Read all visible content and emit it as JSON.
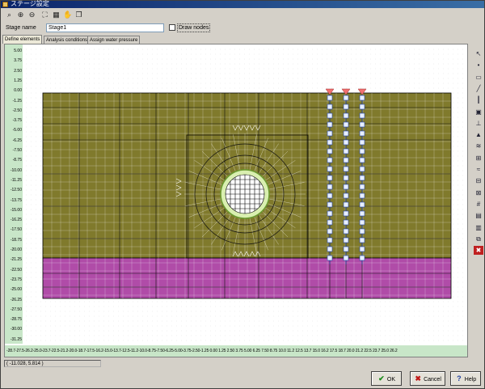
{
  "window": {
    "title": "ステージ設定"
  },
  "toolbar": {
    "icons": [
      "zoom-window-icon",
      "zoom-in-icon",
      "zoom-out-icon",
      "fit-icon",
      "grid-icon",
      "pan-hand-icon",
      "copy-icon"
    ]
  },
  "stage": {
    "label": "Stage name",
    "value": "Stage1",
    "draw_nodes_label": "Draw nodes",
    "draw_nodes_checked": false
  },
  "tabs": [
    {
      "label": "Define elements",
      "active": true
    },
    {
      "label": "Analysis conditions",
      "active": false
    },
    {
      "label": "Assign water pressure",
      "active": false
    }
  ],
  "axes": {
    "y_ticks": [
      "5.00",
      "3.75",
      "2.50",
      "1.25",
      "0.00",
      "-1.25",
      "-2.50",
      "-3.75",
      "-5.00",
      "-6.25",
      "-7.50",
      "-8.75",
      "-10.00",
      "-11.25",
      "-12.50",
      "-13.75",
      "-15.00",
      "-16.25",
      "-17.50",
      "-18.75",
      "-20.00",
      "-21.25",
      "-22.50",
      "-23.75",
      "-25.00",
      "-26.25",
      "-27.50",
      "-28.75",
      "-30.00",
      "-31.25"
    ],
    "x_ticks": "-28.7-27.5-26.2-25.0-23.7-22.5-21.2-20.0-18.7-17.5-16.2-15.0-13.7-12.5-11.2-10.0-8.75-7.50-6.25-5.00-3.75-2.50-1.25 0.00 1.25 2.50 3.75 5.00 6.25 7.50 8.75 10.0 11.2 12.5 13.7 15.0 16.2 17.5 18.7 20.0 21.2 22.5 23.7 25.0 26.2"
  },
  "model": {
    "upper_layer_color": "#807a2c",
    "lower_layer_color": "#b04ca8",
    "tunnel_fill_color": "#d9efb0"
  },
  "right_tools": [
    "select-icon",
    "node-icon",
    "element-icon",
    "line-icon",
    "beam-icon",
    "box-icon",
    "support-icon",
    "load-icon",
    "spring-icon",
    "joint-icon",
    "water-icon",
    "split-icon",
    "merge-icon",
    "renumber-icon",
    "material-icon",
    "layer-icon",
    "copy-element-icon",
    "delete-icon"
  ],
  "status": {
    "coord": "( -11.028,    5.814 )"
  },
  "buttons": {
    "ok": "OK",
    "cancel": "Cancel",
    "help": "Help"
  }
}
